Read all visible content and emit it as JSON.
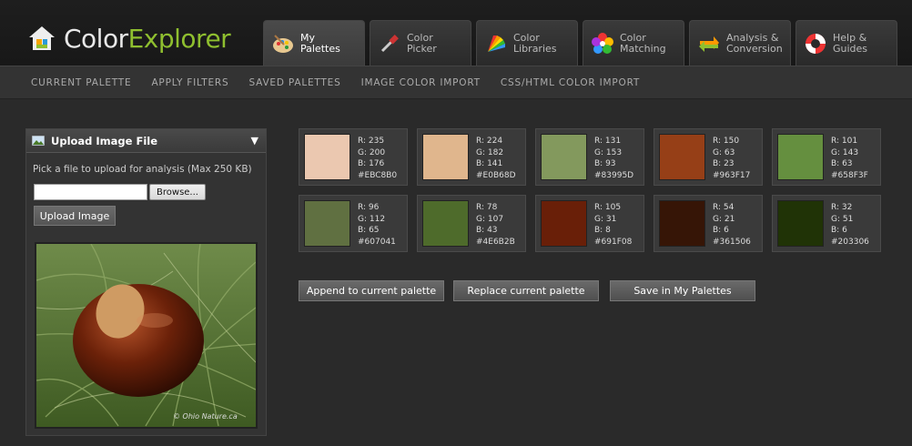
{
  "app": {
    "logo_primary": "Color",
    "logo_accent": "Explorer",
    "brand_color": "#8fbf2f"
  },
  "tabs": [
    {
      "label": "My\nPalettes",
      "icon": "palette-icon",
      "active": true
    },
    {
      "label": "Color\nPicker",
      "icon": "eyedropper-icon",
      "active": false
    },
    {
      "label": "Color\nLibraries",
      "icon": "fan-deck-icon",
      "active": false
    },
    {
      "label": "Color\nMatching",
      "icon": "flower-icon",
      "active": false
    },
    {
      "label": "Analysis &\nConversion",
      "icon": "convert-arrows-icon",
      "active": false
    },
    {
      "label": "Help &\nGuides",
      "icon": "lifebuoy-icon",
      "active": false
    }
  ],
  "subnav": [
    "CURRENT PALETTE",
    "APPLY FILTERS",
    "SAVED PALETTES",
    "IMAGE COLOR IMPORT",
    "CSS/HTML COLOR IMPORT"
  ],
  "panel": {
    "title": "Upload Image File",
    "description": "Pick a file to upload for analysis (Max 250 KB)",
    "file_value": "",
    "browse_label": "Browse...",
    "upload_label": "Upload Image",
    "photo_caption": "© Ohio Nature.ca"
  },
  "swatches": [
    {
      "r": "R: 235",
      "g": "G: 200",
      "b": "B: 176",
      "hex": "#EBC8B0"
    },
    {
      "r": "R: 224",
      "g": "G: 182",
      "b": "B: 141",
      "hex": "#E0B68D"
    },
    {
      "r": "R: 131",
      "g": "G: 153",
      "b": "B: 93",
      "hex": "#83995D"
    },
    {
      "r": "R: 150",
      "g": "G: 63",
      "b": "B: 23",
      "hex": "#963F17"
    },
    {
      "r": "R: 101",
      "g": "G: 143",
      "b": "B: 63",
      "hex": "#658F3F"
    },
    {
      "r": "R: 96",
      "g": "G: 112",
      "b": "B: 65",
      "hex": "#607041"
    },
    {
      "r": "R: 78",
      "g": "G: 107",
      "b": "B: 43",
      "hex": "#4E6B2B"
    },
    {
      "r": "R: 105",
      "g": "G: 31",
      "b": "B: 8",
      "hex": "#691F08"
    },
    {
      "r": "R: 54",
      "g": "G: 21",
      "b": "B: 6",
      "hex": "#361506"
    },
    {
      "r": "R: 32",
      "g": "G: 51",
      "b": "B: 6",
      "hex": "#203306"
    }
  ],
  "actions": [
    {
      "label": "Append to current palette",
      "name": "append-palette-button"
    },
    {
      "label": "Replace current palette",
      "name": "replace-palette-button"
    },
    {
      "label": "Save in My Palettes",
      "name": "save-palette-button"
    }
  ]
}
